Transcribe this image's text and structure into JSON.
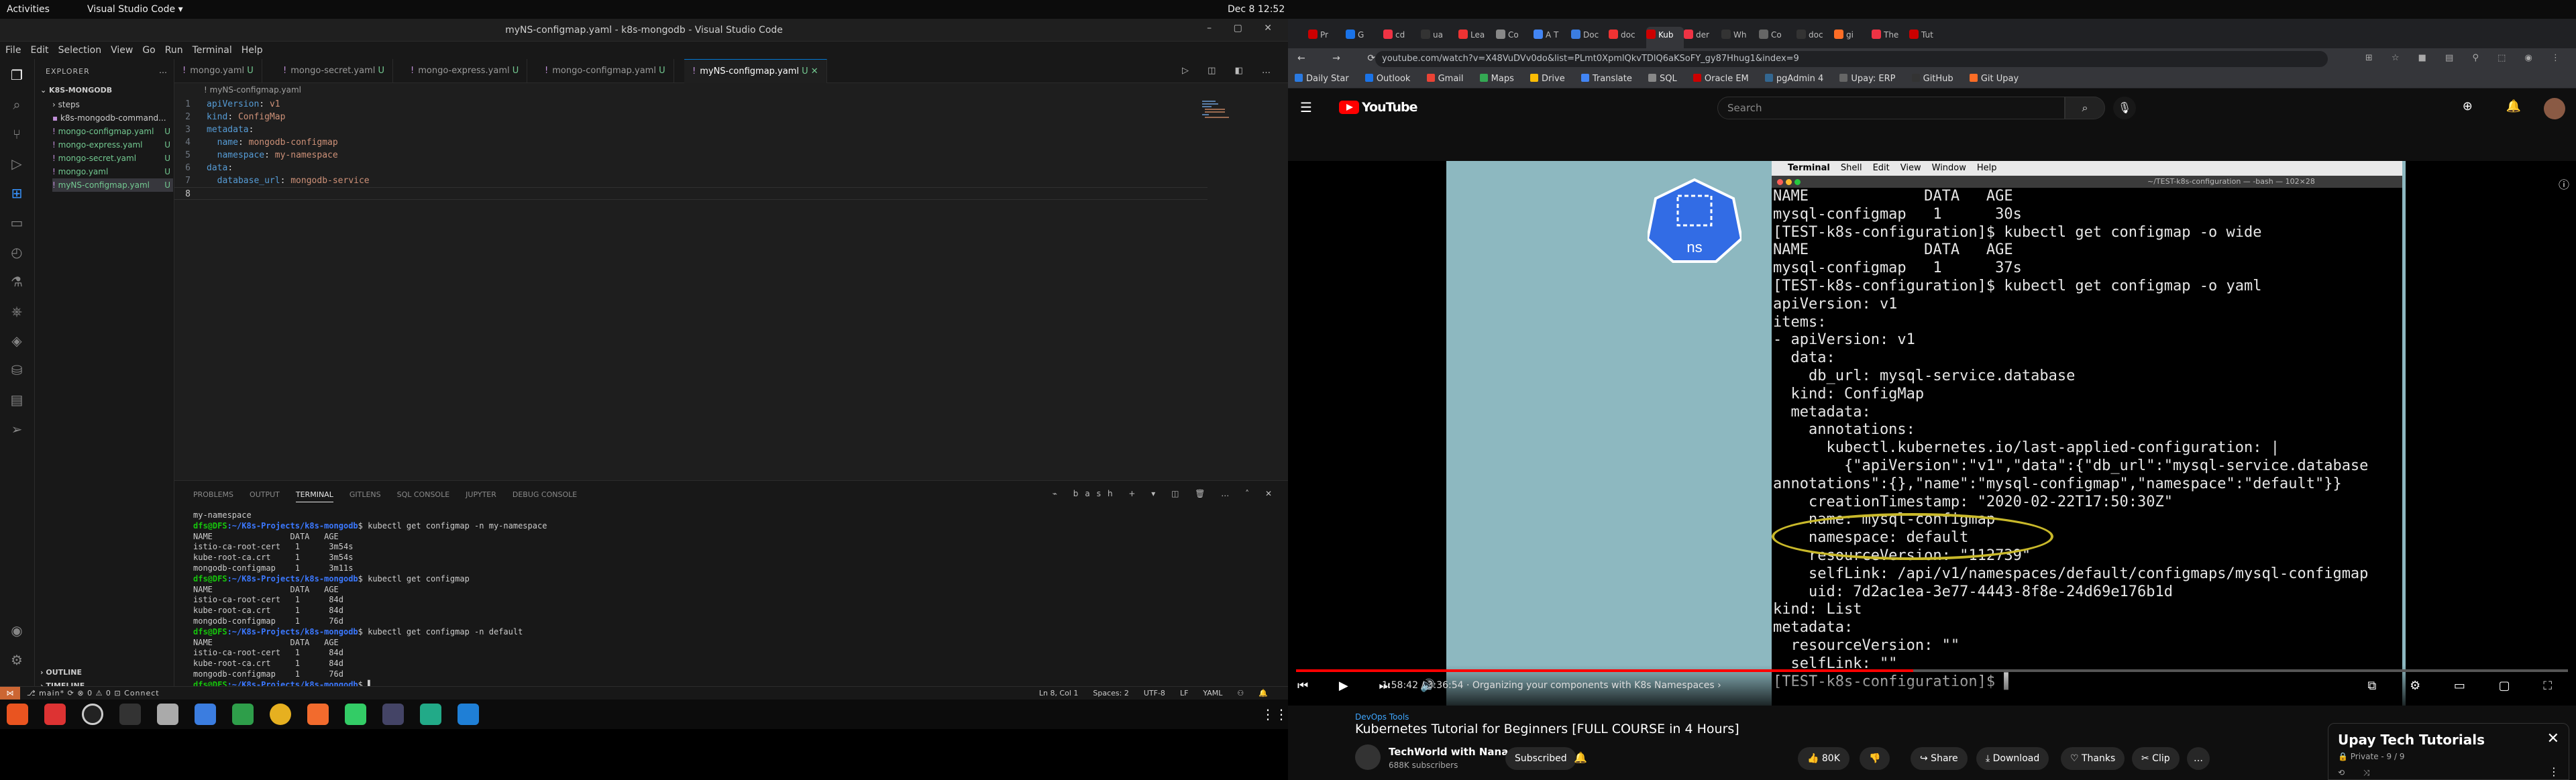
{
  "topbar": {
    "activities": "Activities",
    "app": "Visual Studio Code ▾",
    "clock": "Dec 8  12:52 PM",
    "tray": "⛓ 🔊 ⏻ ▾"
  },
  "vscode": {
    "title": "myNS-configmap.yaml - k8s-mongodb - Visual Studio Code",
    "window_controls": "– ▢ ✕",
    "menu": [
      "File",
      "Edit",
      "Selection",
      "View",
      "Go",
      "Run",
      "Terminal",
      "Help"
    ],
    "explorer_header": "EXPLORER",
    "folder": "K8S-MONGODB",
    "files": [
      {
        "name": "› steps",
        "badge": ""
      },
      {
        "name": "k8s-mongodb-command...",
        "badge": ""
      },
      {
        "name": "mongo-configmap.yaml",
        "badge": "U"
      },
      {
        "name": "mongo-express.yaml",
        "badge": "U"
      },
      {
        "name": "mongo-secret.yaml",
        "badge": "U"
      },
      {
        "name": "mongo.yaml",
        "badge": "U"
      },
      {
        "name": "myNS-configmap.yaml",
        "badge": "U"
      }
    ],
    "outline": "› OUTLINE",
    "timeline": "› TIMELINE",
    "tabs": [
      {
        "label": "mongo.yaml",
        "badge": "U"
      },
      {
        "label": "mongo-secret.yaml",
        "badge": "U"
      },
      {
        "label": "mongo-express.yaml",
        "badge": "U"
      },
      {
        "label": "mongo-configmap.yaml",
        "badge": "U"
      },
      {
        "label": "myNS-configmap.yaml",
        "badge": "U ✕"
      }
    ],
    "breadcrumb": "! myNS-configmap.yaml",
    "code": [
      {
        "n": "1",
        "key": "apiVersion",
        "val": "v1",
        "indent": ""
      },
      {
        "n": "2",
        "key": "kind",
        "val": "ConfigMap",
        "indent": ""
      },
      {
        "n": "3",
        "key": "metadata",
        "val": "",
        "indent": ""
      },
      {
        "n": "4",
        "key": "name",
        "val": "mongodb-configmap",
        "indent": "  "
      },
      {
        "n": "5",
        "key": "namespace",
        "val": "my-namespace",
        "indent": "  "
      },
      {
        "n": "6",
        "key": "data",
        "val": "",
        "indent": ""
      },
      {
        "n": "7",
        "key": "database_url",
        "val": "mongodb-service",
        "indent": "  "
      },
      {
        "n": "8",
        "key": "",
        "val": "",
        "indent": ""
      }
    ],
    "panel_tabs": [
      "PROBLEMS",
      "OUTPUT",
      "TERMINAL",
      "GITLENS",
      "SQL CONSOLE",
      "JUPYTER",
      "DEBUG CONSOLE"
    ],
    "panel_right": "⌁ bash + ▾ ◫ 🗑 … ˄ ✕",
    "terminal": [
      {
        "type": "out",
        "text": "my-namespace"
      },
      {
        "type": "cmd",
        "prompt": "dfs@DFS",
        "path": ":~/K8s-Projects/k8s-mongodb",
        "cmd": "$ kubectl get configmap -n my-namespace"
      },
      {
        "type": "out",
        "text": "NAME                DATA   AGE"
      },
      {
        "type": "out",
        "text": "istio-ca-root-cert   1      3m54s"
      },
      {
        "type": "out",
        "text": "kube-root-ca.crt     1      3m54s"
      },
      {
        "type": "out",
        "text": "mongodb-configmap    1      3m11s"
      },
      {
        "type": "cmd",
        "prompt": "dfs@DFS",
        "path": ":~/K8s-Projects/k8s-mongodb",
        "cmd": "$ kubectl get configmap"
      },
      {
        "type": "out",
        "text": "NAME                DATA   AGE"
      },
      {
        "type": "out",
        "text": "istio-ca-root-cert   1      84d"
      },
      {
        "type": "out",
        "text": "kube-root-ca.crt     1      84d"
      },
      {
        "type": "out",
        "text": "mongodb-configmap    1      76d"
      },
      {
        "type": "cmd",
        "prompt": "dfs@DFS",
        "path": ":~/K8s-Projects/k8s-mongodb",
        "cmd": "$ kubectl get configmap -n default"
      },
      {
        "type": "out",
        "text": "NAME                DATA   AGE"
      },
      {
        "type": "out",
        "text": "istio-ca-root-cert   1      84d"
      },
      {
        "type": "out",
        "text": "kube-root-ca.crt     1      84d"
      },
      {
        "type": "out",
        "text": "mongodb-configmap    1      76d"
      },
      {
        "type": "cmd",
        "prompt": "dfs@DFS",
        "path": ":~/K8s-Projects/k8s-mongodb",
        "cmd": "$ ▌"
      }
    ],
    "status_left": "⎇ main* ⟳ ⊗ 0 ⚠ 0   ⊡ Connect",
    "status_right": [
      "Ln 8, Col 1",
      "Spaces: 2",
      "UTF-8",
      "LF",
      "YAML",
      "⚇",
      "🔔"
    ]
  },
  "chrome": {
    "url": "youtube.com/watch?v=X48VuDVv0do&list=PLmt0XpmlQkvTDlQ6aKSoFY_gy87Hhug1&index=9",
    "nav": "← → ⟳ ⌂",
    "tabs": [
      "Pr",
      "G",
      "cd",
      "ua",
      "Lea",
      "Co",
      "A T",
      "Doc",
      "doc",
      "Kub",
      "der",
      "Wh",
      "Co",
      "doc",
      "gi",
      "The",
      "Tut"
    ],
    "active_tab": "Kub",
    "bookmarks": [
      "Daily Star",
      "Outlook",
      "Gmail",
      "Maps",
      "Drive",
      "Translate",
      "SQL",
      "Oracle EM",
      "pgAdmin 4",
      "Upay: ERP",
      "GitHub",
      "Git Upay"
    ],
    "yt_brand": "YouTube",
    "search_placeholder": "Search",
    "mac_menu": [
      "",
      "Terminal",
      "Shell",
      "Edit",
      "View",
      "Window",
      "Help"
    ],
    "mac_title": "~/TEST-k8s-configuration — -bash — 102×28",
    "k8s_label": "ns",
    "video_terminal": "NAME             DATA   AGE\nmysql-configmap   1      30s\n[TEST-k8s-configuration]$ kubectl get configmap -o wide\nNAME             DATA   AGE\nmysql-configmap   1      37s\n[TEST-k8s-configuration]$ kubectl get configmap -o yaml\napiVersion: v1\nitems:\n- apiVersion: v1\n  data:\n    db_url: mysql-service.database\n  kind: ConfigMap\n  metadata:\n    annotations:\n      kubectl.kubernetes.io/last-applied-configuration: |\n        {\"apiVersion\":\"v1\",\"data\":{\"db_url\":\"mysql-service.database\nannotations\":{},\"name\":\"mysql-configmap\",\"namespace\":\"default\"}}\n    creationTimestamp: \"2020-02-22T17:50:30Z\"\n    name: mysql-configmap\n    namespace: default\n    resourceVersion: \"112739\"\n    selfLink: /api/v1/namespaces/default/configmaps/mysql-configmap\n    uid: 7d2ac1ea-3e77-4443-8f8e-24d69e176b1d\nkind: List\nmetadata:\n  resourceVersion: \"\"\n  selfLink: \"\"\n[TEST-k8s-configuration]$ ▌",
    "progress": 0.485,
    "time": "1:58:42 / 3:36:54  ·  Organizing your components with K8s Namespaces ›",
    "category": "DevOps Tools",
    "video_title": "Kubernetes Tutorial for Beginners [FULL COURSE in 4 Hours]",
    "channel": "TechWorld with Nana",
    "subs": "688K subscribers",
    "subscribe": "Subscribed",
    "likes": "👍 80K",
    "dislike": "👎",
    "share": "↪ Share",
    "download": "⤓ Download",
    "thanks": "♡ Thanks",
    "clip": "✂ Clip",
    "more": "…",
    "playlist_title": "Upay Tech Tutorials",
    "playlist_sub": "🔒 Private - 9 / 9",
    "playlist_icons": "⟲ ⤨",
    "playlist_more": "⋮"
  }
}
